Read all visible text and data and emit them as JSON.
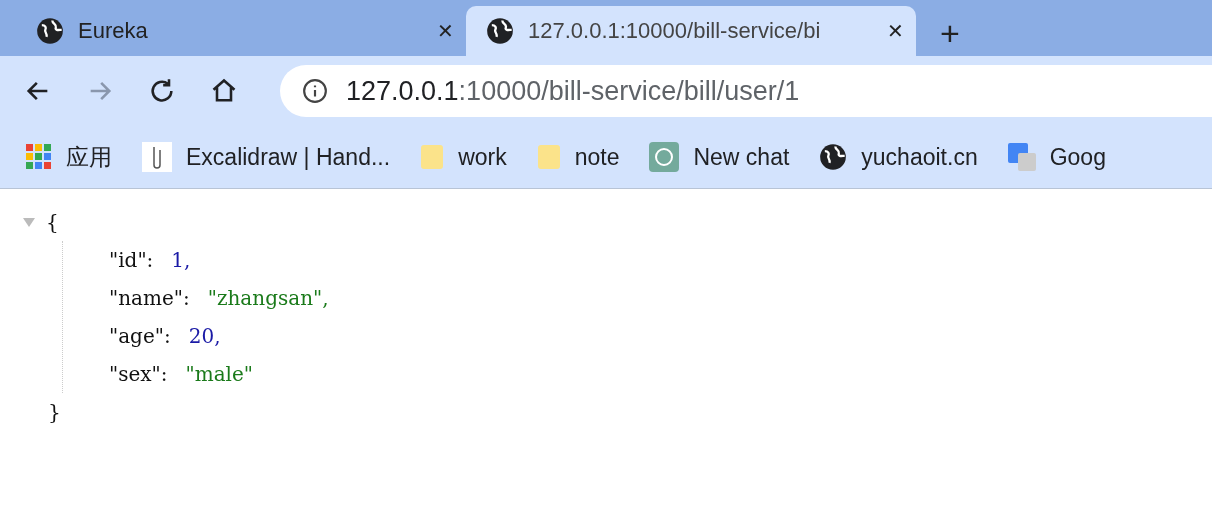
{
  "tabs": [
    {
      "title": "Eureka",
      "selected": false,
      "close": "✕"
    },
    {
      "title": "127.0.0.1:10000/bill-service/bi",
      "selected": true,
      "close": "✕"
    }
  ],
  "new_tab": "+",
  "toolbar": {
    "forward_disabled": true
  },
  "address_bar": {
    "host": "127.0.0.1",
    "path": ":10000/bill-service/bill/user/1"
  },
  "bookmarks": [
    {
      "kind": "apps",
      "label": "应用"
    },
    {
      "kind": "favicon",
      "label": "Excalidraw | Hand..."
    },
    {
      "kind": "folder",
      "label": "work"
    },
    {
      "kind": "folder",
      "label": "note"
    },
    {
      "kind": "chat",
      "label": "New chat"
    },
    {
      "kind": "globe",
      "label": "yuchaoit.cn"
    },
    {
      "kind": "translate",
      "label": "Goog"
    }
  ],
  "json_viewer": {
    "expanded": true,
    "open": "{",
    "close": "}",
    "entries": [
      {
        "key": "\"id\":",
        "value": "1,",
        "kind": "number"
      },
      {
        "key": "\"name\":",
        "value": "\"zhangsan\",",
        "kind": "string"
      },
      {
        "key": "\"age\":",
        "value": "20,",
        "kind": "number"
      },
      {
        "key": "\"sex\":",
        "value": "\"male\"",
        "kind": "string"
      }
    ]
  }
}
